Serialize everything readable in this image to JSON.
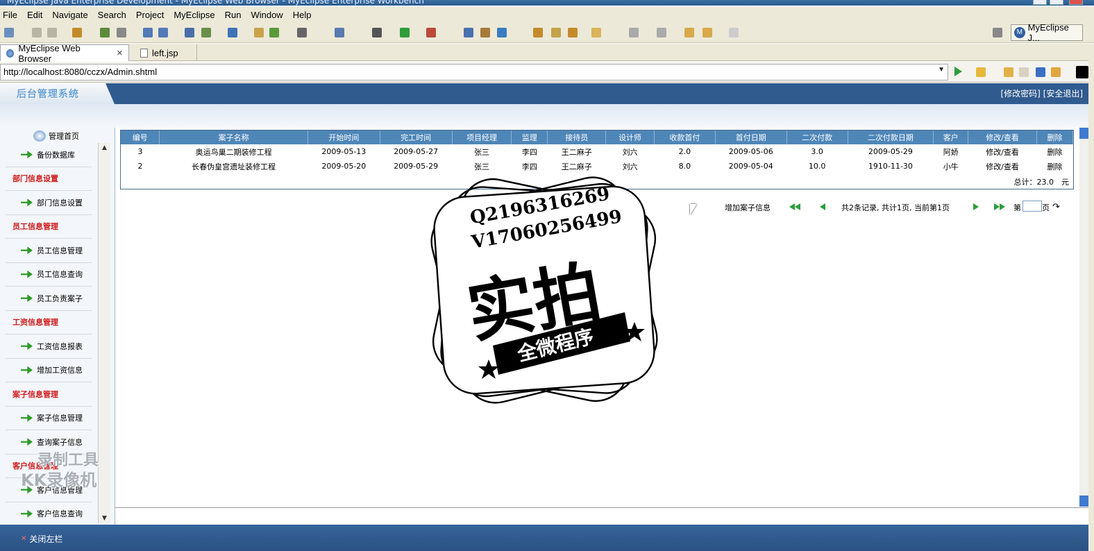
{
  "window": {
    "title": "MyEclipse Java Enterprise Development - MyEclipse Web Browser - MyEclipse Enterprise Workbench"
  },
  "menu": [
    "File",
    "Edit",
    "Navigate",
    "Search",
    "Project",
    "MyEclipse",
    "Run",
    "Window",
    "Help"
  ],
  "perspective": {
    "label": "MyEclipse J..."
  },
  "tabs": [
    {
      "label": "MyEclipse Web Browser",
      "icon": "globe-icon",
      "active": true
    },
    {
      "label": "left.jsp",
      "icon": "jsp-file-icon",
      "active": false
    }
  ],
  "browser": {
    "url": "http://localhost:8080/cczx/Admin.shtml"
  },
  "admin": {
    "logo": "后台管理系统",
    "top_links": "[修改密码] [安全退出]",
    "home": "管理首页",
    "footer_close": "关闭左栏"
  },
  "sidebar": [
    {
      "type": "link",
      "label": "备份数据库"
    },
    {
      "type": "cat",
      "label": "部门信息设置"
    },
    {
      "type": "link",
      "label": "部门信息设置"
    },
    {
      "type": "cat",
      "label": "员工信息管理"
    },
    {
      "type": "link",
      "label": "员工信息管理"
    },
    {
      "type": "link",
      "label": "员工信息查询"
    },
    {
      "type": "link",
      "label": "员工负责案子"
    },
    {
      "type": "cat",
      "label": "工资信息管理"
    },
    {
      "type": "link",
      "label": "工资信息报表"
    },
    {
      "type": "link",
      "label": "增加工资信息"
    },
    {
      "type": "cat",
      "label": "案子信息管理"
    },
    {
      "type": "link",
      "label": "案子信息管理"
    },
    {
      "type": "link",
      "label": "查询案子信息"
    },
    {
      "type": "cat",
      "label": "客户信息管理"
    },
    {
      "type": "link",
      "label": "客户信息管理"
    },
    {
      "type": "link",
      "label": "客户信息查询"
    }
  ],
  "table": {
    "columns": [
      "编号",
      "案子名称",
      "开始时间",
      "完工时间",
      "项目经理",
      "监理",
      "接待员",
      "设计师",
      "收款首付",
      "首付日期",
      "二次付款",
      "二次付款日期",
      "客户",
      "修改/查看",
      "删除"
    ],
    "rows": [
      [
        "3",
        "奥运鸟巢二期装修工程",
        "2009-05-13",
        "2009-05-27",
        "张三",
        "李四",
        "王二麻子",
        "刘六",
        "2.0",
        "2009-05-06",
        "3.0",
        "2009-05-29",
        "阿娇",
        "修改/查看",
        "删除"
      ],
      [
        "2",
        "长春伪皇宫遗址装修工程",
        "2009-05-20",
        "2009-05-29",
        "张三",
        "李四",
        "王二麻子",
        "刘六",
        "8.0",
        "2009-05-04",
        "10.0",
        "1910-11-30",
        "小牛",
        "修改/查看",
        "删除"
      ]
    ],
    "total": "总计：23.0　元"
  },
  "pager": {
    "add": "增加案子信息",
    "summary": "共2条记录, 共计1页, 当前第1页",
    "goto_prefix": "第",
    "goto_suffix": "页"
  },
  "overlay": {
    "stamp_line1": "Q2196316269",
    "stamp_line2": "V17060256499",
    "stamp_big": "实拍",
    "stamp_banner": "全微程序",
    "watermark_line1": "录制工具",
    "watermark_line2": "KK录像机"
  }
}
